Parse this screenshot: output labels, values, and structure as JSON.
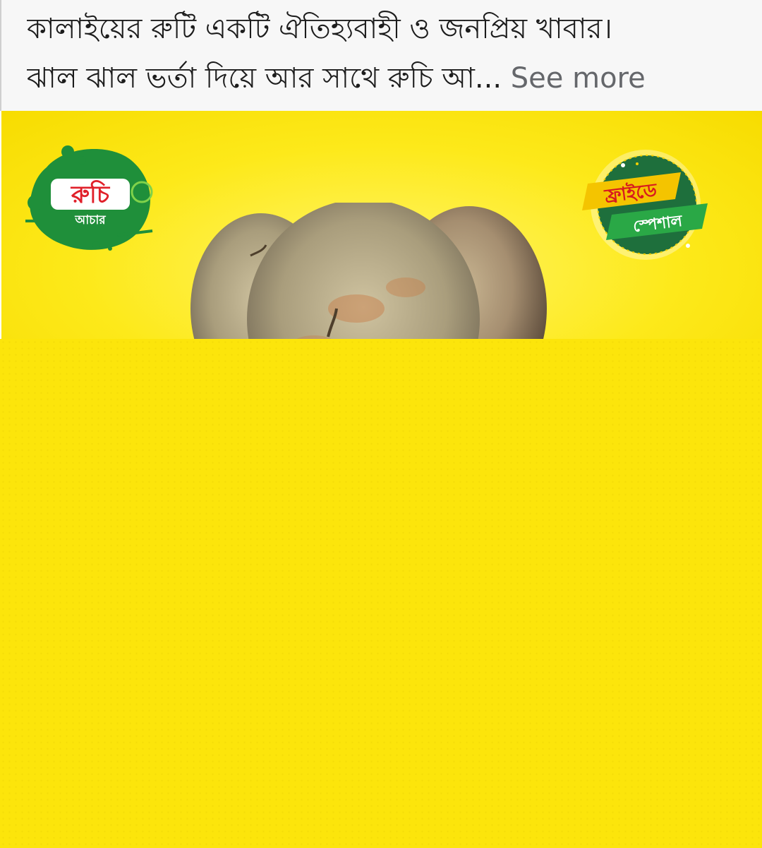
{
  "post": {
    "line1": "কালাইয়ের রুটি একটি ঐতিহ্যবাহী ও জনপ্রিয় খাবার।",
    "line2": "ঝাল ঝাল ভর্তা দিয়ে আর সাথে রুচি আ...",
    "see_more": "See more"
  },
  "image": {
    "brand_logo_main": "রুচি",
    "brand_logo_sub": "আচার",
    "badge_top": "ফ্রাইডে",
    "badge_bottom": "স্পেশাল"
  },
  "colors": {
    "background_yellow": "#fce50b",
    "brand_green": "#1f8f3a",
    "brand_red": "#e0202a",
    "see_more_gray": "#65676b"
  }
}
